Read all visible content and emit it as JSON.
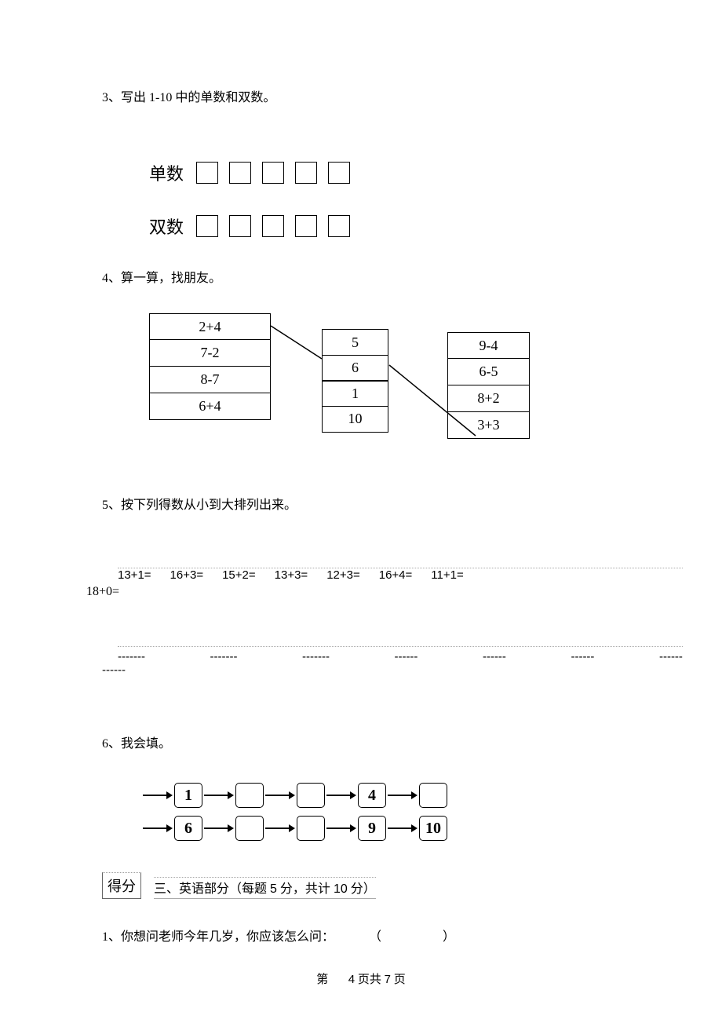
{
  "q3": {
    "prompt": "3、写出 1-10 中的单数和双数。",
    "odd_label": "单数",
    "even_label": "双数"
  },
  "q4": {
    "prompt": "4、算一算，找朋友。",
    "left": [
      "2+4",
      "7-2",
      "8-7",
      "6+4"
    ],
    "mid": [
      "5",
      "6",
      "1",
      "10"
    ],
    "right": [
      "9-4",
      "6-5",
      "8+2",
      "3+3"
    ]
  },
  "q5": {
    "prompt": "5、按下列得数从小到大排列出来。",
    "equations": [
      "13+1=",
      "16+3=",
      "15+2=",
      "13+3=",
      "12+3=",
      "16+4=",
      "11+1="
    ],
    "equation_last": "18+0=",
    "blanks": [
      "-------",
      "-------",
      "-------",
      "------",
      "------",
      "------",
      "------"
    ],
    "blank_last": "------"
  },
  "q6": {
    "prompt": "6、我会填。",
    "row1": [
      "1",
      "",
      "",
      "4",
      ""
    ],
    "row2": [
      "6",
      "",
      "",
      "9",
      "10"
    ]
  },
  "section": {
    "score_label": "得分",
    "title_prefix": "三、英语部分（每题 ",
    "title_mid": "5",
    "title_between": " 分，共计 ",
    "title_points": "10",
    "title_suffix": " 分）"
  },
  "qE1": {
    "prompt_a": "1、你想问老师今年几岁，你应该怎么问：",
    "prompt_b": "（",
    "prompt_c": "）"
  },
  "pager": {
    "a": "第",
    "b": "4",
    "c": "页共",
    "d": "7",
    "e": "页"
  }
}
